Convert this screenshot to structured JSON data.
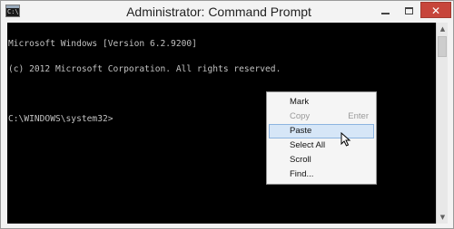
{
  "window": {
    "title": "Administrator: Command Prompt",
    "icon_label": "C:\\",
    "buttons": {
      "minimize": "minimize-icon",
      "maximize": "maximize-icon",
      "close": "✕"
    }
  },
  "console": {
    "lines": [
      "Microsoft Windows [Version 6.2.9200]",
      "(c) 2012 Microsoft Corporation. All rights reserved.",
      "",
      "C:\\WINDOWS\\system32>"
    ],
    "background_color": "#000000",
    "text_color": "#c0c0c0"
  },
  "context_menu": {
    "items": [
      {
        "label": "Mark",
        "enabled": true
      },
      {
        "label": "Copy",
        "accelerator": "Enter",
        "enabled": false
      },
      {
        "label": "Paste",
        "enabled": true,
        "highlighted": true
      },
      {
        "label": "Select All",
        "enabled": true
      },
      {
        "label": "Scroll",
        "enabled": true
      },
      {
        "label": "Find...",
        "enabled": true
      }
    ],
    "highlight_color": "#d6e6f7"
  },
  "colors": {
    "close_button": "#c7453b"
  }
}
